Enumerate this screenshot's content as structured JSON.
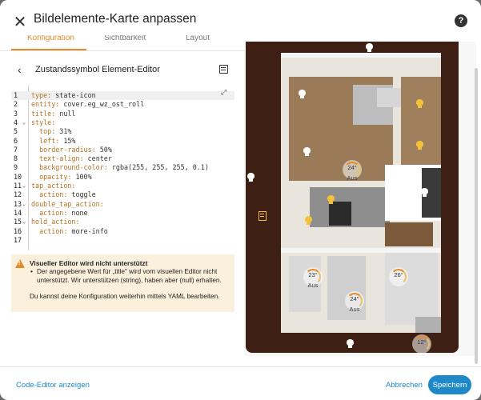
{
  "header": {
    "title": "Bildelemente-Karte anpassen"
  },
  "tabs": [
    {
      "label": "Konfiguration",
      "active": true
    },
    {
      "label": "Sichtbarkeit",
      "active": false
    },
    {
      "label": "Layout",
      "active": false
    }
  ],
  "subheader": {
    "title": "Zustandssymbol Element-Editor"
  },
  "code_lines": [
    {
      "num": "1",
      "fold": "",
      "key": "type:",
      "value": " state-icon"
    },
    {
      "num": "2",
      "fold": "",
      "key": "entity:",
      "value": " cover.eg_wz_ost_roll"
    },
    {
      "num": "3",
      "fold": "",
      "key": "title:",
      "value": " null"
    },
    {
      "num": "4",
      "fold": "⌄",
      "key": "style:",
      "value": ""
    },
    {
      "num": "5",
      "fold": "",
      "key": "  top:",
      "value": " 31%"
    },
    {
      "num": "6",
      "fold": "",
      "key": "  left:",
      "value": " 15%"
    },
    {
      "num": "7",
      "fold": "",
      "key": "  border-radius:",
      "value": " 50%"
    },
    {
      "num": "8",
      "fold": "",
      "key": "  text-align:",
      "value": " center"
    },
    {
      "num": "9",
      "fold": "",
      "key": "  background-color:",
      "value": " rgba(255, 255, 255, 0.1)"
    },
    {
      "num": "10",
      "fold": "",
      "key": "  opacity:",
      "value": " 100%"
    },
    {
      "num": "11",
      "fold": "⌄",
      "key": "tap_action:",
      "value": ""
    },
    {
      "num": "12",
      "fold": "",
      "key": "  action:",
      "value": " toggle"
    },
    {
      "num": "13",
      "fold": "⌄",
      "key": "double_tap_action:",
      "value": ""
    },
    {
      "num": "14",
      "fold": "",
      "key": "  action:",
      "value": " none"
    },
    {
      "num": "15",
      "fold": "⌄",
      "key": "hold_action:",
      "value": ""
    },
    {
      "num": "16",
      "fold": "",
      "key": "  action:",
      "value": " more-info"
    },
    {
      "num": "17",
      "fold": "",
      "key": "",
      "value": ""
    }
  ],
  "warning": {
    "title": "Visueller Editor wird nicht unterstützt",
    "bullet": "Der angegebene Wert für „title\" wird vom visuellen Editor nicht unterstützt. Wir unterstützen (string), haben aber (null) erhalten.",
    "footer": "Du kannst deine Konfiguration weiterhin mittels YAML bearbeiten."
  },
  "preview": {
    "thermostats": [
      {
        "value": "24°",
        "state": "Aus"
      },
      {
        "value": "23°",
        "state": "Aus"
      },
      {
        "value": "26°",
        "state": ""
      },
      {
        "value": "24°",
        "state": "Aus"
      },
      {
        "value": "12°",
        "state": ""
      }
    ]
  },
  "footer": {
    "code_editor_label": "Code-Editor anzeigen",
    "cancel_label": "Abbrechen",
    "save_label": "Speichern"
  },
  "colors": {
    "accent": "#e38b2a",
    "primary": "#1e88c9",
    "warning_bg": "#fbf0dc"
  }
}
